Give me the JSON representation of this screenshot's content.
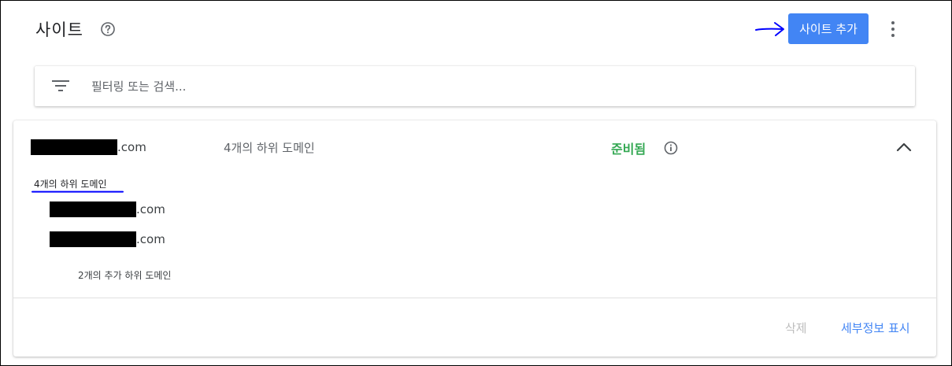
{
  "header": {
    "title": "사이트",
    "help_icon": "help-circle-icon",
    "add_site_label": "사이트 추가",
    "more_icon": "more-vert-icon"
  },
  "search": {
    "filter_icon": "filter-icon",
    "placeholder": "필터링 또는 검색..."
  },
  "site": {
    "name_suffix": ".com",
    "subdomain_summary": "4개의 하위 도메인",
    "status": "준비됨",
    "status_color": "#34a853",
    "info_icon": "info-icon",
    "collapse_icon": "chevron-up-icon",
    "subdomain_heading": "4개의 하위 도메인",
    "subdomains": [
      {
        "suffix": ".com"
      },
      {
        "suffix": ".com"
      }
    ],
    "more_subdomains": "2개의 추가 하위 도메인",
    "delete_label": "삭제",
    "details_label": "세부정보 표시"
  },
  "colors": {
    "accent": "#4285f4",
    "annotation": "#0000ff"
  }
}
